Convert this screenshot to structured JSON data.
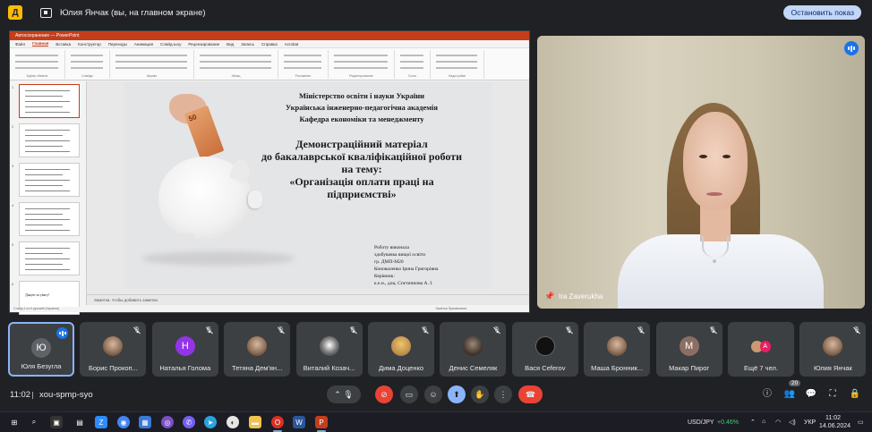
{
  "topbar": {
    "share_title": "Юлия Янчак (вы, на главном экране)",
    "stop_button": "Остановить показ"
  },
  "presentation": {
    "title_bar": "Автосохранение — PowerPoint",
    "tabs": [
      "Файл",
      "Главная",
      "Вставка",
      "Конструктор",
      "Переходы",
      "Анимация",
      "Слайд-шоу",
      "Рецензирование",
      "Вид",
      "Запись",
      "Справка",
      "Acrobat"
    ],
    "active_tab": "Главная",
    "ribbon_groups": [
      "Буфер обмена",
      "Слайды",
      "Шрифт",
      "Абзац",
      "Рисование",
      "Редактирование",
      "Голос",
      "Надстройки"
    ],
    "notes_placeholder": "Заметки, чтобы добавить заметки",
    "status_left": "Слайд 1 из 6    русский (Украина)",
    "status_right": "Заметки   Примечания",
    "thumbnails": [
      {
        "num": "1",
        "text": ""
      },
      {
        "num": "2",
        "text": ""
      },
      {
        "num": "3",
        "text": ""
      },
      {
        "num": "4",
        "text": ""
      },
      {
        "num": "5",
        "text": ""
      },
      {
        "num": "6",
        "text": "Дякую за увагу!"
      }
    ],
    "slide": {
      "org1": "Міністерство освіти і науки України",
      "org2": "Українська інженерно-педагогічна академія",
      "org3": "Кафедра економіки та менеджменту",
      "h1": "Демонстраційний матеріал",
      "h2": "до бакалаврської кваліфікаційної роботи",
      "h3": "на тему:",
      "h4": "«Організація оплати праці на",
      "h5": "підприємстві»",
      "author1": "Роботу виконала",
      "author2": "здобувачка вищої освіти",
      "author3": "гр. ДМП-М20",
      "author4": "Коноваленко Ірина Григорівна",
      "author5": "Керівник:",
      "author6": "к.е.н., доц. Спєтипнова А. І.",
      "banknote": "50"
    }
  },
  "speaker": {
    "name": "Ira Zaverukha"
  },
  "participants": [
    {
      "name": "Юля Безугла",
      "initial": "Ю",
      "color": "#5f6368",
      "kind": "initial",
      "active": true,
      "muted": false
    },
    {
      "name": "Борис Прокоп...",
      "initial": "",
      "color": "",
      "kind": "photo",
      "muted": true
    },
    {
      "name": "Наталья Голома",
      "initial": "Н",
      "color": "#9334e6",
      "kind": "initial",
      "muted": true
    },
    {
      "name": "Тетяна Дем'ян...",
      "initial": "",
      "color": "",
      "kind": "photo",
      "muted": true
    },
    {
      "name": "Виталий Козач...",
      "initial": "",
      "color": "",
      "kind": "bw",
      "muted": true
    },
    {
      "name": "Дима Доценко",
      "initial": "",
      "color": "",
      "kind": "yellow",
      "muted": true
    },
    {
      "name": "Денис Семеляк",
      "initial": "",
      "color": "",
      "kind": "dark",
      "muted": true
    },
    {
      "name": "Вася Ceferov",
      "initial": "",
      "color": "",
      "kind": "tool",
      "muted": true
    },
    {
      "name": "Маша Бронник...",
      "initial": "",
      "color": "",
      "kind": "photo",
      "muted": true
    },
    {
      "name": "Макар Пирог",
      "initial": "М",
      "color": "#8d6e63",
      "kind": "initial",
      "muted": true
    },
    {
      "name": "Ещё 7 чел.",
      "initial": "A",
      "color": "#e91e63",
      "kind": "more",
      "muted": false
    },
    {
      "name": "Юлия Янчак",
      "initial": "",
      "color": "",
      "kind": "photo",
      "muted": true
    }
  ],
  "bottom": {
    "time": "11:02",
    "meeting_code": "xou-spmp-syo",
    "participants_count": "20"
  },
  "taskbar": {
    "ticker": "USD/JPY",
    "ticker_change": "+0.46%",
    "lang": "УКР",
    "clock_time": "11:02",
    "clock_date": "14.06.2024"
  },
  "colors": {
    "accent": "#8ab4f8",
    "end_call": "#ea4335",
    "powerpoint": "#c43e1c",
    "ticker_green": "#3fcf6f"
  }
}
